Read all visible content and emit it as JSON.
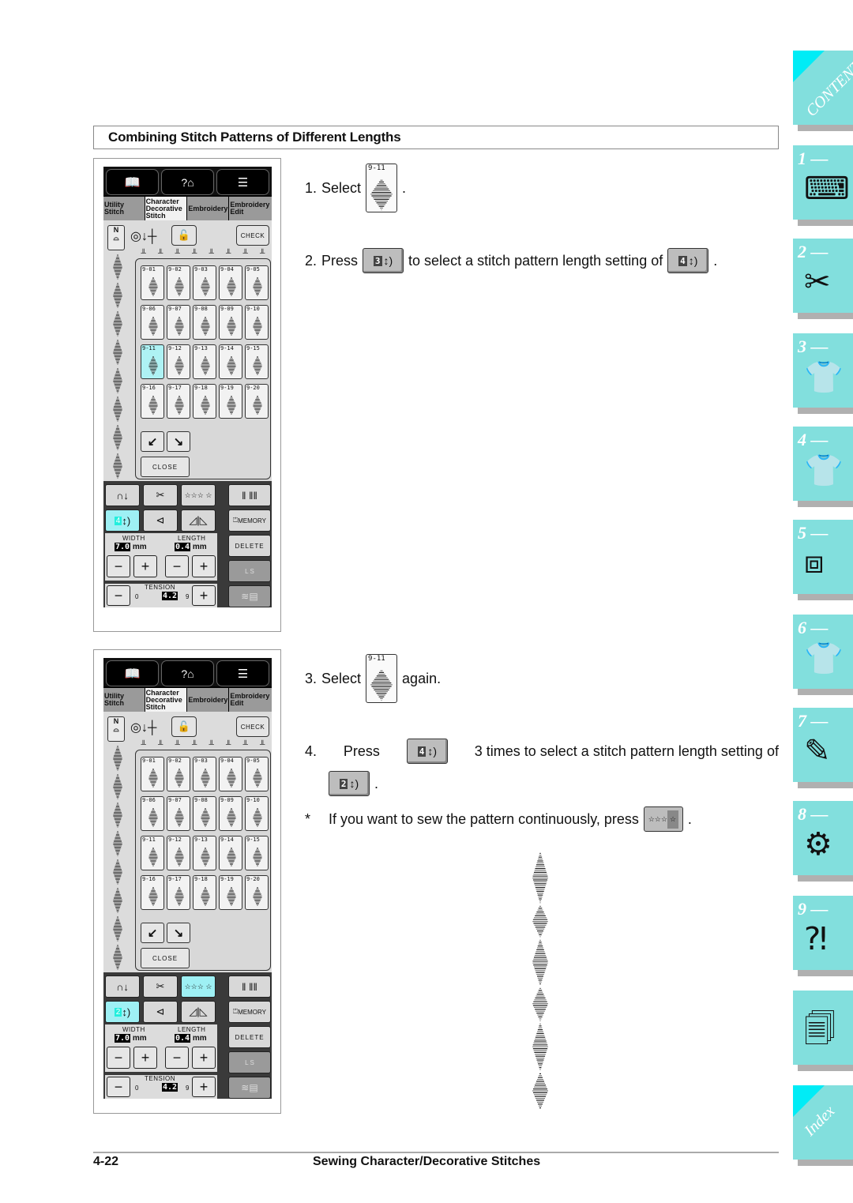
{
  "section": {
    "title": "Combining Stitch Patterns of Different Lengths"
  },
  "lcd": {
    "tabs": [
      {
        "label": "Utility Stitch",
        "active": false
      },
      {
        "label": "Character Decorative Stitch",
        "active": true
      },
      {
        "label": "Embroidery",
        "active": false
      },
      {
        "label": "Embroidery Edit",
        "active": false
      }
    ],
    "topbar_icons": [
      "manual-icon",
      "help-machine-icon",
      "settings-list-icon"
    ],
    "presser_foot": "N",
    "check_label": "CHECK",
    "close_label": "CLOSE",
    "patterns": [
      "9-01",
      "9-02",
      "9-03",
      "9-04",
      "9-05",
      "9-06",
      "9-07",
      "9-08",
      "9-09",
      "9-10",
      "9-11",
      "9-12",
      "9-13",
      "9-14",
      "9-15",
      "9-16",
      "9-17",
      "9-18",
      "9-19",
      "9-20"
    ],
    "selected_pattern": "9-11",
    "memory_label": "MEMORY",
    "delete_label": "DELETE",
    "ls_label": "L  S",
    "width_label": "WIDTH",
    "width_value": "7.0",
    "length_label": "LENGTH",
    "length_value": "0.4",
    "unit": "mm",
    "tension_label": "TENSION",
    "tension_value": "4.2",
    "tension_min": "0",
    "tension_max": "9"
  },
  "panel1": {
    "length_setting": "4",
    "continuous_active": false
  },
  "panel2": {
    "length_setting": "2",
    "continuous_active": true
  },
  "steps": {
    "s1": {
      "num": "1.",
      "text": "Select",
      "after": ".",
      "pattern": "9-11"
    },
    "s2": {
      "num": "2.",
      "pre": "Press",
      "btn1": "3",
      "mid": "to select a stitch pattern length setting of",
      "btn2": "4",
      "after": "."
    },
    "s3": {
      "num": "3.",
      "text": "Select",
      "after": "again.",
      "pattern": "9-11"
    },
    "s4": {
      "num": "4.",
      "pre": "Press",
      "btn1": "4",
      "mid": "3 times to select a stitch pattern length setting of",
      "btn2": "2",
      "after": "."
    },
    "note": {
      "mark": "*",
      "text": "If you want to sew the pattern continuously, press",
      "after": "."
    }
  },
  "footer": {
    "page": "4-22",
    "title": "Sewing Character/Decorative Stitches"
  },
  "side_tabs": [
    {
      "label": "CONTENTS",
      "icon": "contents"
    },
    {
      "label": "1 —",
      "icon": "sewing-machine-hand-icon"
    },
    {
      "label": "2 —",
      "icon": "thread-spool-scissors-icon"
    },
    {
      "label": "3 —",
      "icon": "shirt-stitch-icon"
    },
    {
      "label": "4 —",
      "icon": "shirt-abc-icon"
    },
    {
      "label": "5 —",
      "icon": "embroidery-frame-icon"
    },
    {
      "label": "6 —",
      "icon": "shirt-abc-arc-icon"
    },
    {
      "label": "7 —",
      "icon": "shirt-pen-icon"
    },
    {
      "label": "8 —",
      "icon": "machine-maintenance-icon"
    },
    {
      "label": "9 —",
      "icon": "machine-trouble-icon"
    },
    {
      "label": "",
      "icon": "documents-icon"
    },
    {
      "label": "Index",
      "icon": "index"
    }
  ]
}
